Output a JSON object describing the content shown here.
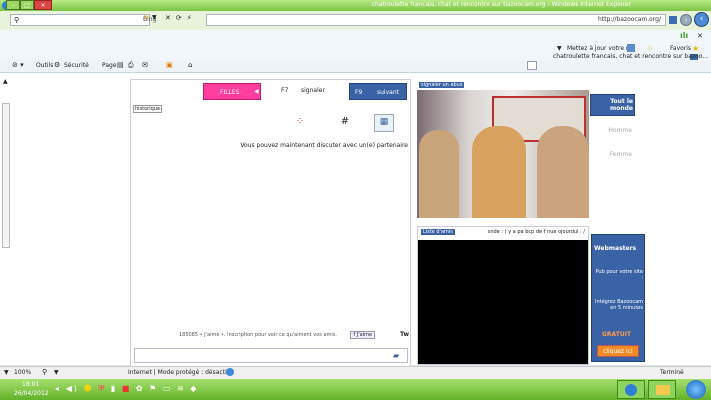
{
  "window": {
    "title": "chatroulette francais, chat et rencontre sur bazoocam.org - Windows Internet Explorer",
    "min": "–",
    "max": "□",
    "close": "✕"
  },
  "address": {
    "url": "http://bazoocam.org/",
    "search_placeholder": "Bing"
  },
  "favorites": {
    "favoris_label": "Favoris",
    "suggest_label": "Mettez à jour votre n...",
    "tab_title": "chatroulette francais, chat et rencontre sur bazoo..."
  },
  "commands": {
    "page": "Page",
    "securite": "Sécurité",
    "outils": "Outils",
    "help": "?"
  },
  "chat": {
    "filles_btn": "FILLES",
    "f7_key": "F7",
    "signaler": "signaler",
    "f9_key": "F9",
    "suivant": "suivant",
    "historique": "historique",
    "message": "Vous pouvez maintenant discuter avec un(e) partenaire",
    "footer_tw": "Tw",
    "footer_fb": "f J'aime",
    "footer_text": "185085 • J'aime •. Inscription pour voir ce qu'aiment vos amis."
  },
  "video": {
    "report_tag": "signaler un abus",
    "friends_tag": "Liste d'amis",
    "remote_caption": "snde : ) y a pa bcp de f nue ojourdui : /"
  },
  "filters": {
    "tout": "Tout le monde",
    "homme": "Homme",
    "femme": "Femme"
  },
  "ad": {
    "title": "Webmasters",
    "line1": "Pub pour votre site :",
    "line2": "Intégrez Bazoocam en 5 minutes",
    "gratuit": "GRATUIT",
    "cta": "cliquez ici"
  },
  "status": {
    "text": "Terminé",
    "zone": "Internet | Mode protégé : désactivé",
    "zoom": "100%"
  },
  "taskbar": {
    "time": "18:01",
    "date": "26/04/2012"
  },
  "colors": {
    "accent_blue": "#3a63a6",
    "pink": "#ff3d9c",
    "title_green": "#7cc444"
  }
}
